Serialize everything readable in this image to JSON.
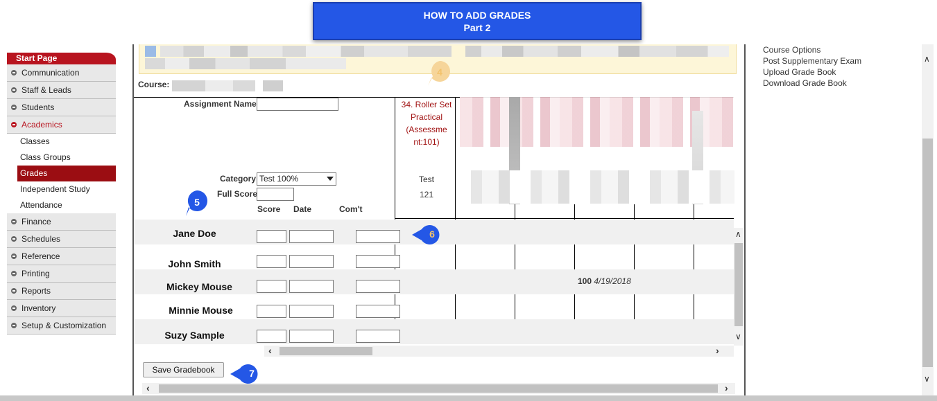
{
  "banner": {
    "title": "HOW TO ADD GRADES",
    "subtitle": "Part 2"
  },
  "sidebar": {
    "start_page": "Start Page",
    "items": [
      {
        "label": "Communication"
      },
      {
        "label": "Staff & Leads"
      },
      {
        "label": "Students"
      },
      {
        "label": "Academics",
        "active": true
      },
      {
        "label": "Classes",
        "sub": true
      },
      {
        "label": "Class Groups",
        "sub": true
      },
      {
        "label": "Grades",
        "sub": true,
        "selected": true
      },
      {
        "label": "Independent Study",
        "sub": true
      },
      {
        "label": "Attendance",
        "sub": true
      },
      {
        "label": "Finance"
      },
      {
        "label": "Schedules"
      },
      {
        "label": "Reference"
      },
      {
        "label": "Printing"
      },
      {
        "label": "Reports"
      },
      {
        "label": "Inventory"
      },
      {
        "label": "Setup & Customization"
      }
    ]
  },
  "right_links": [
    "Course Options",
    "Post Supplementary Exam",
    "Upload Grade Book",
    "Download Grade Book"
  ],
  "course": {
    "label": "Course:"
  },
  "form": {
    "assignment_name_label": "Assignment Name",
    "category_label": "Category",
    "category_value": "Test 100%",
    "full_score_label": "Full Score",
    "score_header": "Score",
    "date_header": "Date",
    "comment_header": "Com't"
  },
  "assignment": {
    "title": "34. Roller Set Practical (Assessment:101)",
    "title_lines": [
      "34. Roller Set",
      "Practical",
      "(Assessme",
      "nt:101)"
    ],
    "category": "Test",
    "full_score": "121"
  },
  "students": [
    "Jane Doe",
    "John Smith",
    "Mickey Mouse",
    "Minnie Mouse",
    "Suzy Sample"
  ],
  "grade_entry": {
    "student": "Mickey Mouse",
    "score": "100",
    "date": "4/19/2018"
  },
  "buttons": {
    "save": "Save Gradebook"
  },
  "markers": [
    "4",
    "5",
    "6",
    "7"
  ],
  "colors": {
    "banner": "#2457e6",
    "accent": "#b8141f",
    "selected": "#9b0d12",
    "marker": "#2457e6"
  }
}
